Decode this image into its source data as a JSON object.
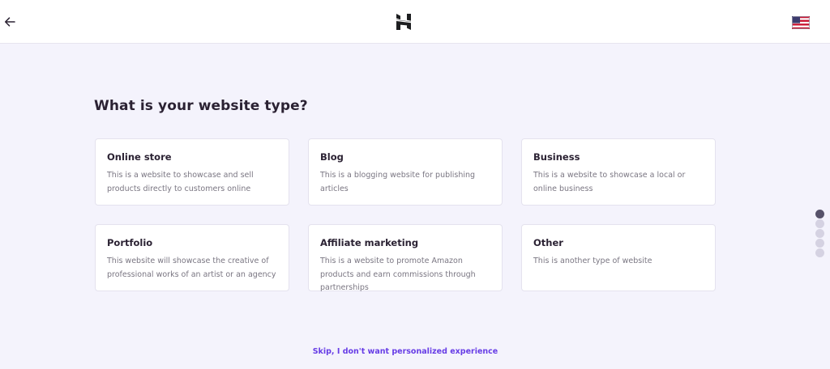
{
  "header": {
    "back_icon": "arrow-left-icon",
    "logo_icon": "hostinger-logo-icon",
    "language_icon": "us-flag-icon"
  },
  "main": {
    "title": "What is your website type?",
    "cards": [
      {
        "title": "Online store",
        "description": "This is a website to showcase and sell products directly to customers online"
      },
      {
        "title": "Blog",
        "description": "This is a blogging website for publishing articles"
      },
      {
        "title": "Business",
        "description": "This is a website to showcase a local or online business"
      },
      {
        "title": "Portfolio",
        "description": "This website will showcase the creative of professional works of an artist or an agency"
      },
      {
        "title": "Affiliate marketing",
        "description": "This is a website to promote Amazon products and earn commissions through partnerships"
      },
      {
        "title": "Other",
        "description": "This is another type of website"
      }
    ]
  },
  "progress": {
    "total_steps": 5,
    "current_step": 1
  },
  "skip_link": "Skip, I don't want personalized experience",
  "colors": {
    "accent": "#673de6",
    "background": "#f4f3fc",
    "heading": "#2b2233"
  }
}
